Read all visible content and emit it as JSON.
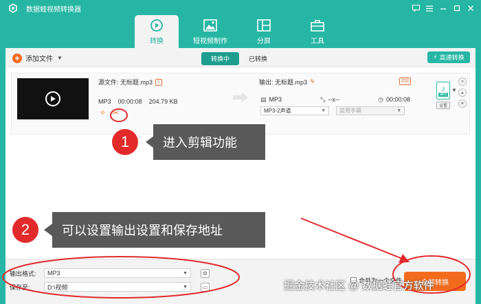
{
  "app": {
    "title": "数据蛙视频转换器"
  },
  "nav": {
    "tabs": [
      {
        "label": "转换",
        "icon": "convert-icon",
        "active": true
      },
      {
        "label": "短视频制作",
        "icon": "image-icon",
        "active": false
      },
      {
        "label": "分屏",
        "icon": "split-screen-icon",
        "active": false
      },
      {
        "label": "工具",
        "icon": "toolbox-icon",
        "active": false
      }
    ]
  },
  "toolbar": {
    "add_file": "添加文件",
    "seg_converting": "转换中",
    "seg_converted": "已转换",
    "fast_convert": "高速转换"
  },
  "file": {
    "source_label": "源文件: 无标题.mp3",
    "format": "MP3",
    "duration": "00:00:08",
    "size": "204.79 KB",
    "output_label": "输出: 无标题.mp3",
    "out_format": "MP3",
    "out_resolution": "--x--",
    "out_duration": "00:00:08",
    "audio_channel": "MP3-2声道",
    "subtitle": "禁用字幕",
    "format_type": "MP3",
    "settings": "设置",
    "id3": "ID3"
  },
  "bottom": {
    "output_format_label": "输出格式:",
    "output_format_value": "MP3",
    "save_to_label": "保存至:",
    "save_to_value": "D:\\视频",
    "merge_label": "合并为一个文件",
    "convert_all": "全部转换"
  },
  "annotations": {
    "step1_number": "1",
    "step1_text": "进入剪辑功能",
    "step2_number": "2",
    "step2_text": "可以设置输出设置和保存地址",
    "watermark": "掘金技术社区 @ 数据蛙官方软件"
  },
  "colors": {
    "accent": "#27b6a4",
    "orange": "#f26b1d",
    "annotation_red": "#e22a2a"
  }
}
